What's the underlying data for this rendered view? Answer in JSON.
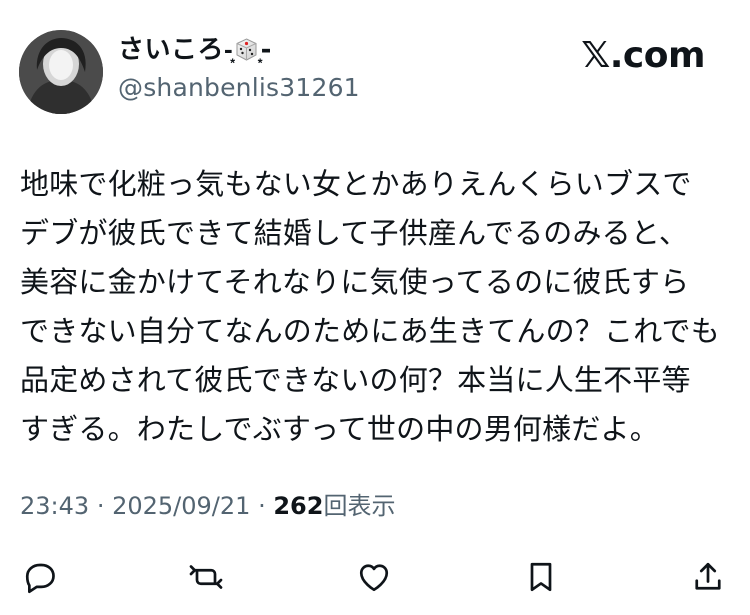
{
  "header": {
    "display_name_prefix": "さいころ-͙",
    "display_name_icon": "dice-icon",
    "display_name_suffix": "͙-",
    "username": "@shanbenlis31261",
    "brand": "𝕏.com"
  },
  "tweet": {
    "lines": [
      "地味で化粧っ気もない女とかありえんくらいブスで",
      "デブが彼氏できて結婚して子供産んでるのみると、",
      "美容に金かけてそれなりに気使ってるのに彼氏すら",
      "できない自分てなんのためにあ生きてんの？これでも",
      "品定めされて彼氏できないの何？本当に人生不平等",
      "すぎる。わたしでぶすって世の中の男何様だよ。"
    ]
  },
  "meta": {
    "time": "23:43",
    "separator": "·",
    "date": "2025/09/21",
    "views_count": "262",
    "views_label": "回表示"
  },
  "actions": [
    {
      "icon": "reply-icon"
    },
    {
      "icon": "repost-icon"
    },
    {
      "icon": "like-icon"
    },
    {
      "icon": "bookmark-icon"
    },
    {
      "icon": "share-icon"
    }
  ],
  "colors": {
    "text_primary": "#0f1419",
    "text_secondary": "#536471",
    "background": "#ffffff"
  }
}
